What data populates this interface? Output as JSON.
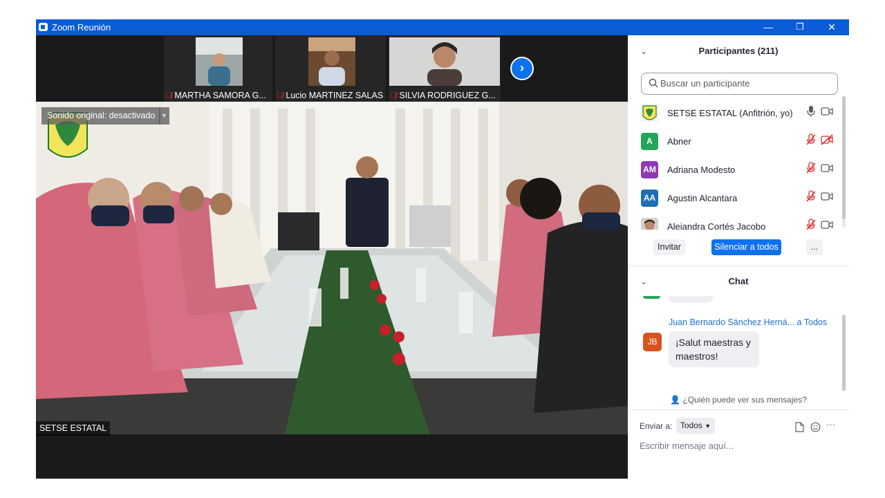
{
  "window": {
    "title": "Zoom Reunión",
    "minimize_glyph": "—",
    "restore_glyph": "❐",
    "close_glyph": "✕"
  },
  "thumbnails": [
    {
      "name": "MARTHA SAMORA G...",
      "muted": true
    },
    {
      "name": "Lucio MARTINEZ SALAS",
      "muted": true
    },
    {
      "name": "SILVIA RODRIGUEZ G...",
      "muted": true
    }
  ],
  "main_video": {
    "original_sound_label": "Sonido original: desactivado",
    "speaker_label": "SETSE ESTATAL"
  },
  "participants": {
    "title": "Participantes (211)",
    "search_placeholder": "Buscar un participante",
    "list": [
      {
        "name": "SETSE ESTATAL (Anfitrión, yo)",
        "initials": "",
        "avatar": "logo",
        "color": "#f3f3f3",
        "mic_muted": false,
        "cam_off": false
      },
      {
        "name": "Abner",
        "initials": "A",
        "avatar": "initials",
        "color": "#23a55a",
        "mic_muted": true,
        "cam_off": true
      },
      {
        "name": "Adriana Modesto",
        "initials": "AM",
        "avatar": "initials",
        "color": "#8f3ab5",
        "mic_muted": true,
        "cam_off": false
      },
      {
        "name": "Agustin Alcantara",
        "initials": "AA",
        "avatar": "initials",
        "color": "#1f6fb2",
        "mic_muted": true,
        "cam_off": false
      },
      {
        "name": "Alejandra Cortés Jacobo",
        "initials": "",
        "avatar": "photo",
        "color": "#b88a6d",
        "mic_muted": true,
        "cam_off": false
      }
    ],
    "invite_label": "Invitar",
    "mute_all_label": "Silenciar a todos",
    "more_label": "..."
  },
  "chat": {
    "title": "Chat",
    "message": {
      "sender": "Juan Bernardo Sánchez Herná...",
      "to": "a Todos",
      "initials": "JB",
      "avatar_color": "#d9531e",
      "line1": "¡Salut maestras y",
      "line2": "maestros!"
    },
    "who_can_see": "¿Quién puede ver sus mensajes?",
    "send_to_label": "Enviar a:",
    "send_to_value": "Todos",
    "input_placeholder": "Escribir mensaje aquí...",
    "more_glyph": "···"
  },
  "colors": {
    "accent": "#0e72ed",
    "titlebar": "#0b5cd6",
    "muted_red": "#e02828"
  }
}
